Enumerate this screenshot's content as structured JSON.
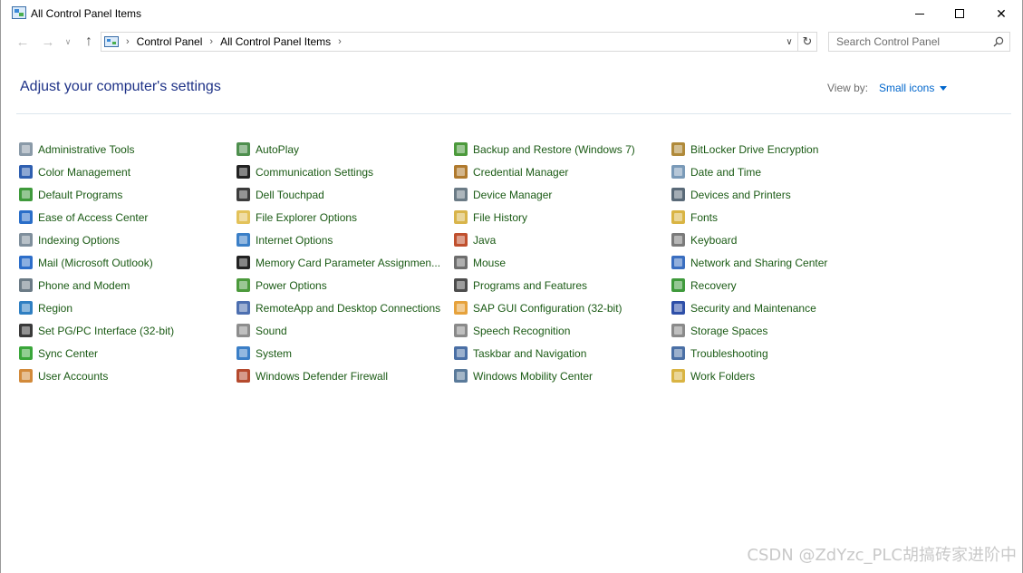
{
  "window": {
    "title": "All Control Panel Items",
    "controls": {
      "minimize": "minimize",
      "maximize": "maximize",
      "close": "✕"
    }
  },
  "address": {
    "breadcrumbs": [
      "Control Panel",
      "All Control Panel Items"
    ],
    "search_placeholder": "Search Control Panel"
  },
  "header": {
    "heading": "Adjust your computer's settings",
    "view_by_label": "View by:",
    "view_by_value": "Small icons"
  },
  "columns": [
    [
      {
        "label": "Administrative Tools",
        "color": "#8a9aa8"
      },
      {
        "label": "Color Management",
        "color": "#2f5fb0"
      },
      {
        "label": "Default Programs",
        "color": "#3f9a3c"
      },
      {
        "label": "Ease of Access Center",
        "color": "#2a6ec8"
      },
      {
        "label": "Indexing Options",
        "color": "#7f8f9c"
      },
      {
        "label": "Mail (Microsoft Outlook)",
        "color": "#2d6ec9"
      },
      {
        "label": "Phone and Modem",
        "color": "#6b7b86"
      },
      {
        "label": "Region",
        "color": "#2f7fc2"
      },
      {
        "label": "Set PG/PC Interface (32-bit)",
        "color": "#3a3a3a"
      },
      {
        "label": "Sync Center",
        "color": "#3aa63a"
      },
      {
        "label": "User Accounts",
        "color": "#d28a3a"
      }
    ],
    [
      {
        "label": "AutoPlay",
        "color": "#4e8f4e"
      },
      {
        "label": "Communication Settings",
        "color": "#222222"
      },
      {
        "label": "Dell Touchpad",
        "color": "#3c3c3c"
      },
      {
        "label": "File Explorer Options",
        "color": "#e3c25a"
      },
      {
        "label": "Internet Options",
        "color": "#3b7fc7"
      },
      {
        "label": "Memory Card Parameter Assignmen...",
        "color": "#222222"
      },
      {
        "label": "Power Options",
        "color": "#4c9a3c"
      },
      {
        "label": "RemoteApp and Desktop Connections",
        "color": "#4d6fb0"
      },
      {
        "label": "Sound",
        "color": "#8d8d8d"
      },
      {
        "label": "System",
        "color": "#3b7fc7"
      },
      {
        "label": "Windows Defender Firewall",
        "color": "#b54a2e"
      }
    ],
    [
      {
        "label": "Backup and Restore (Windows 7)",
        "color": "#4c9a3c"
      },
      {
        "label": "Credential Manager",
        "color": "#b07a2e"
      },
      {
        "label": "Device Manager",
        "color": "#6b7b86"
      },
      {
        "label": "File History",
        "color": "#d8b44a"
      },
      {
        "label": "Java",
        "color": "#c0502e"
      },
      {
        "label": "Mouse",
        "color": "#6e6e6e"
      },
      {
        "label": "Programs and Features",
        "color": "#4d4d4d"
      },
      {
        "label": "SAP GUI Configuration (32-bit)",
        "color": "#e6a23c"
      },
      {
        "label": "Speech Recognition",
        "color": "#8a8a8a"
      },
      {
        "label": "Taskbar and Navigation",
        "color": "#4a6fa5"
      },
      {
        "label": "Windows Mobility Center",
        "color": "#5a7a9a"
      }
    ],
    [
      {
        "label": "BitLocker Drive Encryption",
        "color": "#b08a3a"
      },
      {
        "label": "Date and Time",
        "color": "#7a9ab8"
      },
      {
        "label": "Devices and Printers",
        "color": "#5a6a78"
      },
      {
        "label": "Fonts",
        "color": "#d9b443"
      },
      {
        "label": "Keyboard",
        "color": "#7a7a7a"
      },
      {
        "label": "Network and Sharing Center",
        "color": "#3a6ec0"
      },
      {
        "label": "Recovery",
        "color": "#3f9a3c"
      },
      {
        "label": "Security and Maintenance",
        "color": "#2e4fa8"
      },
      {
        "label": "Storage Spaces",
        "color": "#8a8a8a"
      },
      {
        "label": "Troubleshooting",
        "color": "#4a6fa5"
      },
      {
        "label": "Work Folders",
        "color": "#d9b443"
      }
    ]
  ],
  "watermark": "CSDN @ZdYzc_PLC胡搞砖家进阶中"
}
